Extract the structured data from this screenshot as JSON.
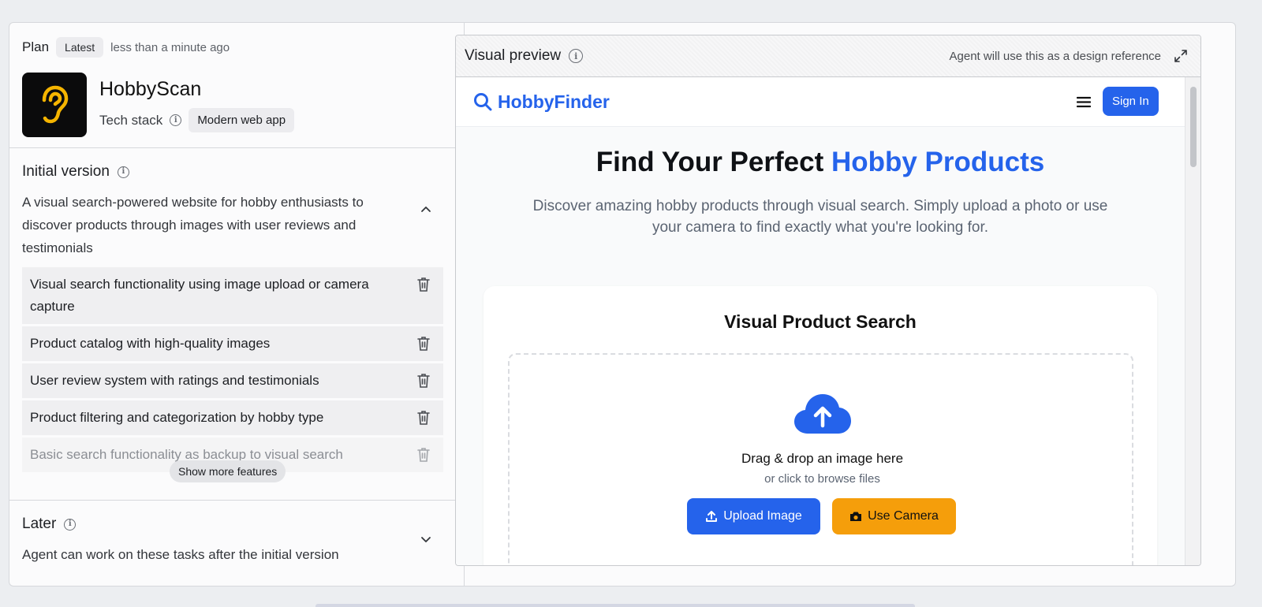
{
  "plan": {
    "label": "Plan",
    "badge": "Latest",
    "timestamp": "less than a minute ago"
  },
  "app": {
    "name": "HobbyScan",
    "icon": "ear-icon",
    "tech_stack_label": "Tech stack",
    "tech_stack_value": "Modern web app"
  },
  "initial_version": {
    "title": "Initial version",
    "description": "A visual search-powered website for hobby enthusiasts to discover products through images with user reviews and testimonials",
    "features": [
      "Visual search functionality using image upload or camera capture",
      "Product catalog with high-quality images",
      "User review system with ratings and testimonials",
      "Product filtering and categorization by hobby type",
      "Basic search functionality as backup to visual search"
    ],
    "show_more_label": "Show more features"
  },
  "later": {
    "title": "Later",
    "description": "Agent can work on these tasks after the initial version"
  },
  "preview": {
    "title": "Visual preview",
    "note": "Agent will use this as a design reference"
  },
  "site": {
    "brand": "HobbyFinder",
    "signin_label": "Sign In",
    "hero_title_plain": "Find Your Perfect ",
    "hero_title_accent": "Hobby Products",
    "hero_subtitle": "Discover amazing hobby products through visual search. Simply upload a photo or use your camera to find exactly what you're looking for.",
    "search_title": "Visual Product Search",
    "dropzone_title": "Drag & drop an image here",
    "dropzone_subtitle": "or click to browse files",
    "upload_label": "Upload Image",
    "camera_label": "Use Camera"
  },
  "colors": {
    "accent_blue": "#2563eb",
    "camera_orange": "#f59e0b",
    "ear_yellow": "#f5b400"
  }
}
